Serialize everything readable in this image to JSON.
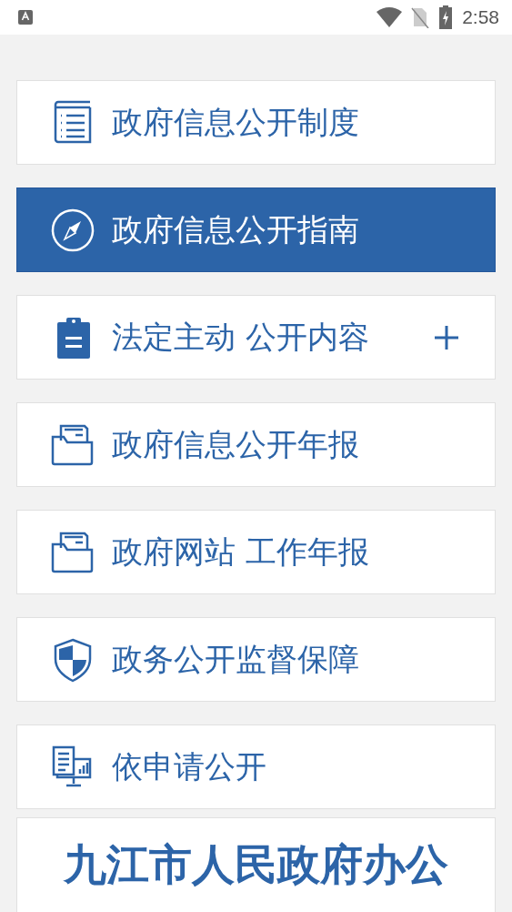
{
  "status_bar": {
    "time": "2:58"
  },
  "menu": [
    {
      "label": "政府信息公开制度",
      "kind": "document",
      "selected": false,
      "expandable": false
    },
    {
      "label": "政府信息公开指南",
      "kind": "compass",
      "selected": true,
      "expandable": false
    },
    {
      "label": "法定主动 公开内容",
      "kind": "clipboard",
      "selected": false,
      "expandable": true
    },
    {
      "label": "政府信息公开年报",
      "kind": "folder",
      "selected": false,
      "expandable": false
    },
    {
      "label": "政府网站 工作年报",
      "kind": "folder",
      "selected": false,
      "expandable": false
    },
    {
      "label": "政务公开监督保障",
      "kind": "shield",
      "selected": false,
      "expandable": false
    },
    {
      "label": "依申请公开",
      "kind": "monitor",
      "selected": false,
      "expandable": false
    }
  ],
  "footer_title": "九江市人民政府办公"
}
